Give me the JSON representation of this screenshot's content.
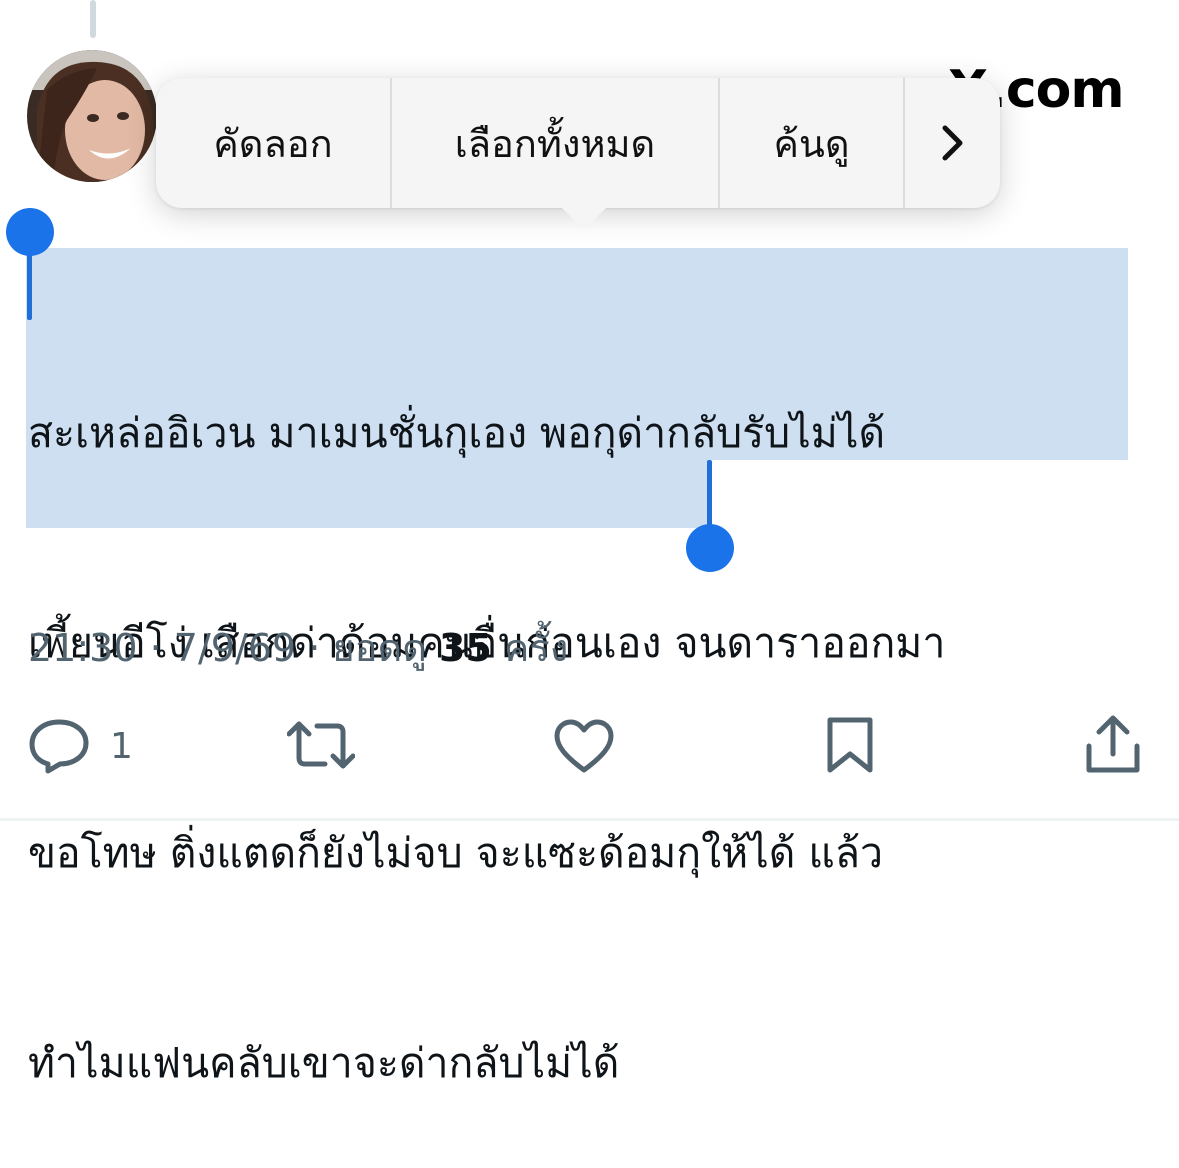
{
  "brand": "X.com",
  "context_menu": {
    "copy": "คัดลอก",
    "select_all": "เลือกทั้งหมด",
    "look_up": "ค้นดู",
    "more": "›"
  },
  "tweet": {
    "lines": [
      "สะเหล่ออิเวน มาเมนชั่นกุเอง พอกุด่ากลับรับไม่ได้",
      "เพี้ยนอีโง่ เสือกด่าด้อมคนอื่นก่อนเอง จนดาราออกมา",
      "ขอโทษ ติ่งแตดก็ยังไม่จบ จะแซะด้อมกุให้ได้ แล้ว",
      "ทำไมแฟนคลับเขาจะด่ากลับไม่ได้"
    ]
  },
  "meta": {
    "time": "21:30",
    "date": "7/9/69",
    "views_prefix": "ยอดดู",
    "views_count": "35",
    "views_suffix": "ครั้ง",
    "separator": "·"
  },
  "actions": {
    "reply_count": "1",
    "icons": [
      "reply-icon",
      "retweet-icon",
      "like-icon",
      "bookmark-icon",
      "share-icon"
    ]
  },
  "colors": {
    "selection": "#cddff0",
    "handle": "#1a73e8",
    "muted": "#536471"
  }
}
